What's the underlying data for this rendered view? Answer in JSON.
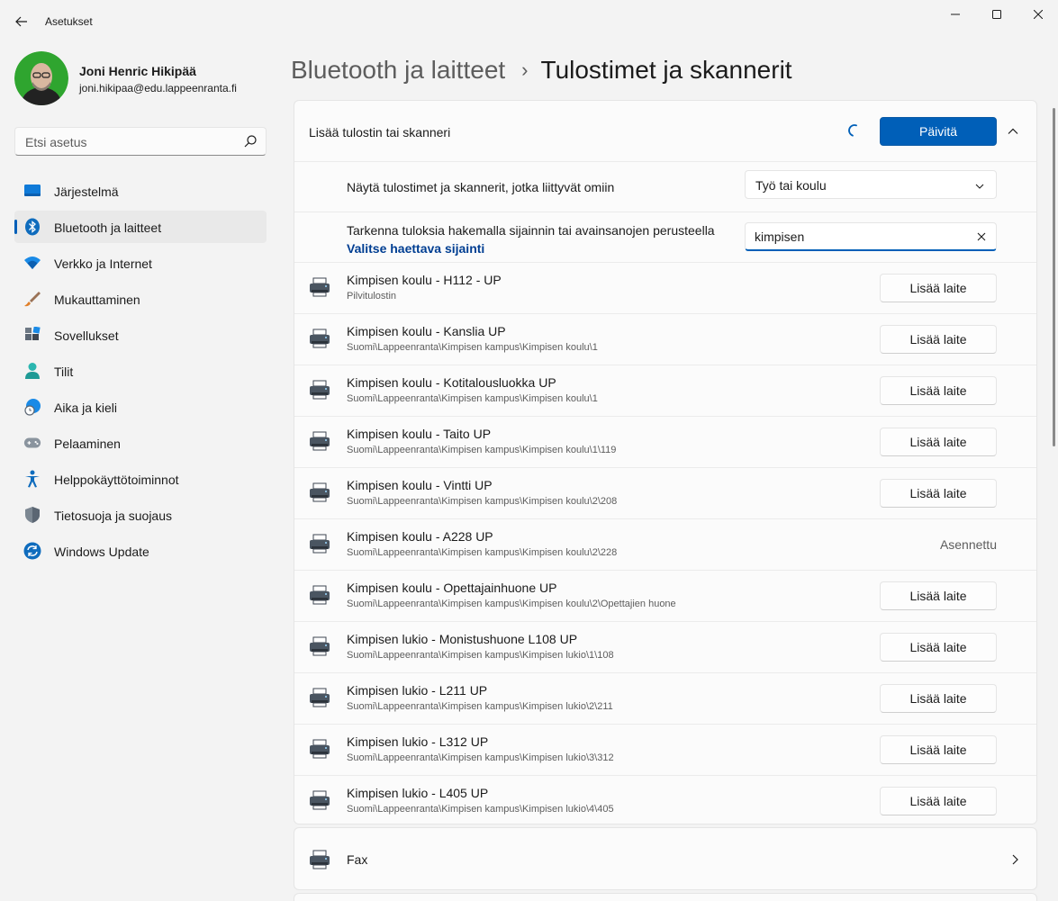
{
  "window": {
    "title": "Asetukset"
  },
  "profile": {
    "name": "Joni Henric Hikipää",
    "email": "joni.hikipaa@edu.lappeenranta.fi"
  },
  "search": {
    "placeholder": "Etsi asetus"
  },
  "sidebar": {
    "items": [
      {
        "label": "Järjestelmä",
        "icon": "system-icon",
        "active": false
      },
      {
        "label": "Bluetooth ja laitteet",
        "icon": "bluetooth-icon",
        "active": true
      },
      {
        "label": "Verkko ja Internet",
        "icon": "wifi-icon",
        "active": false
      },
      {
        "label": "Mukauttaminen",
        "icon": "brush-icon",
        "active": false
      },
      {
        "label": "Sovellukset",
        "icon": "apps-icon",
        "active": false
      },
      {
        "label": "Tilit",
        "icon": "account-icon",
        "active": false
      },
      {
        "label": "Aika ja kieli",
        "icon": "globe-clock-icon",
        "active": false
      },
      {
        "label": "Pelaaminen",
        "icon": "gamepad-icon",
        "active": false
      },
      {
        "label": "Helppokäyttötoiminnot",
        "icon": "accessibility-icon",
        "active": false
      },
      {
        "label": "Tietosuoja ja suojaus",
        "icon": "shield-icon",
        "active": false
      },
      {
        "label": "Windows Update",
        "icon": "update-icon",
        "active": false
      }
    ]
  },
  "breadcrumb": {
    "parent": "Bluetooth ja laitteet",
    "separator": "›",
    "current": "Tulostimet ja skannerit"
  },
  "add_section": {
    "label": "Lisää tulostin tai skanneri",
    "refresh_label": "Päivitä",
    "show_label": "Näytä tulostimet ja skannerit, jotka liittyvät omiin",
    "show_value": "Työ tai koulu",
    "refine_label": "Tarkenna tuloksia hakemalla sijainnin tai avainsanojen perusteella",
    "refine_link": "Valitse haettava sijainti",
    "search_value": "kimpisen"
  },
  "printers": [
    {
      "name": "Kimpisen koulu - H112 - UP",
      "location": "Pilvitulostin",
      "action": "Lisää laite",
      "installed": false
    },
    {
      "name": "Kimpisen koulu - Kanslia UP",
      "location": "Suomi\\Lappeenranta\\Kimpisen kampus\\Kimpisen koulu\\1",
      "action": "Lisää laite",
      "installed": false
    },
    {
      "name": "Kimpisen koulu - Kotitalousluokka UP",
      "location": "Suomi\\Lappeenranta\\Kimpisen kampus\\Kimpisen koulu\\1",
      "action": "Lisää laite",
      "installed": false
    },
    {
      "name": "Kimpisen koulu - Taito UP",
      "location": "Suomi\\Lappeenranta\\Kimpisen kampus\\Kimpisen koulu\\1\\119",
      "action": "Lisää laite",
      "installed": false
    },
    {
      "name": "Kimpisen koulu - Vintti UP",
      "location": "Suomi\\Lappeenranta\\Kimpisen kampus\\Kimpisen koulu\\2\\208",
      "action": "Lisää laite",
      "installed": false
    },
    {
      "name": "Kimpisen koulu - A228 UP",
      "location": "Suomi\\Lappeenranta\\Kimpisen kampus\\Kimpisen koulu\\2\\228",
      "action": "Asennettu",
      "installed": true
    },
    {
      "name": "Kimpisen koulu - Opettajainhuone UP",
      "location": "Suomi\\Lappeenranta\\Kimpisen kampus\\Kimpisen koulu\\2\\Opettajien huone",
      "action": "Lisää laite",
      "installed": false
    },
    {
      "name": "Kimpisen lukio - Monistushuone L108 UP",
      "location": "Suomi\\Lappeenranta\\Kimpisen kampus\\Kimpisen lukio\\1\\108",
      "action": "Lisää laite",
      "installed": false
    },
    {
      "name": "Kimpisen lukio - L211 UP",
      "location": "Suomi\\Lappeenranta\\Kimpisen kampus\\Kimpisen lukio\\2\\211",
      "action": "Lisää laite",
      "installed": false
    },
    {
      "name": "Kimpisen lukio - L312 UP",
      "location": "Suomi\\Lappeenranta\\Kimpisen kampus\\Kimpisen lukio\\3\\312",
      "action": "Lisää laite",
      "installed": false
    },
    {
      "name": "Kimpisen lukio - L405 UP",
      "location": "Suomi\\Lappeenranta\\Kimpisen kampus\\Kimpisen lukio\\4\\405",
      "action": "Lisää laite",
      "installed": false
    }
  ],
  "fax": {
    "label": "Fax"
  },
  "colors": {
    "accent": "#005fb8",
    "link": "#003e92",
    "background": "#f3f3f3",
    "card": "#fbfbfb"
  }
}
